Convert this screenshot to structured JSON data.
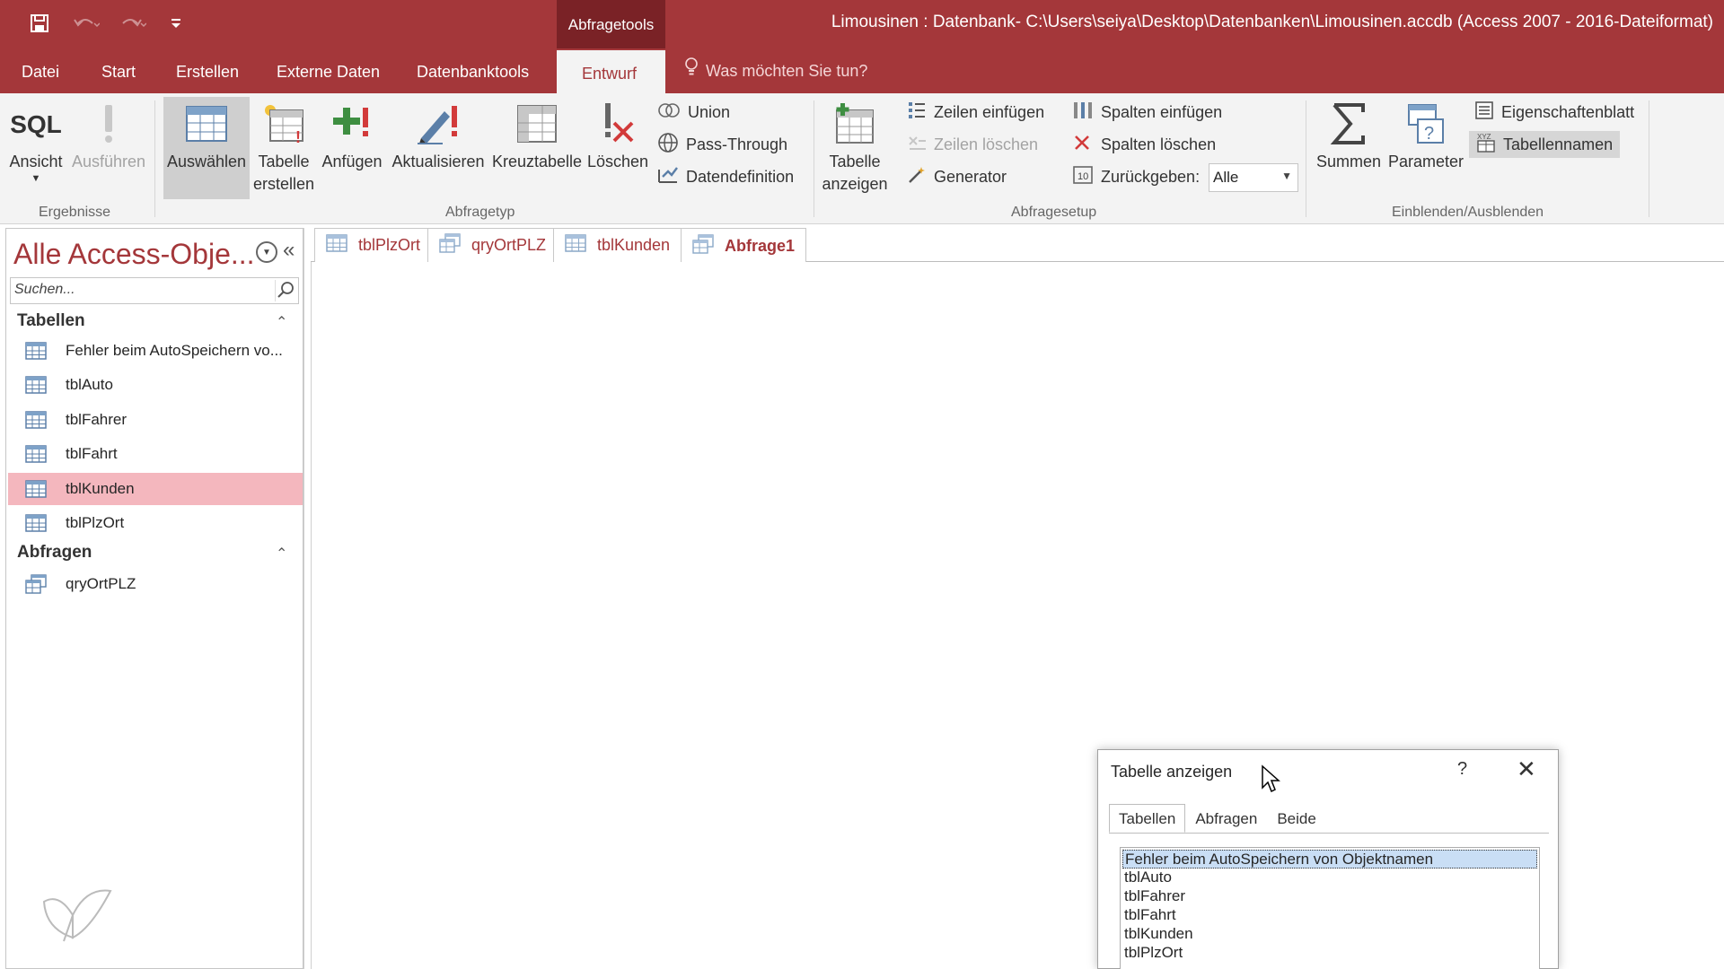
{
  "titlebar": {
    "context_tab_header": "Abfragetools",
    "window_title": "Limousinen : Datenbank- C:\\Users\\seiya\\Desktop\\Datenbanken\\Limousinen.accdb (Access 2007 - 2016-Dateiformat)",
    "qat_icons": [
      "save-icon",
      "undo-icon",
      "redo-icon",
      "customize-qat-icon"
    ]
  },
  "ribbon_tabs": {
    "datei": "Datei",
    "start": "Start",
    "erstellen": "Erstellen",
    "externe_daten": "Externe Daten",
    "datenbanktools": "Datenbanktools",
    "entwurf": "Entwurf",
    "tell_me": "Was möchten Sie tun?"
  },
  "ribbon": {
    "ergebnisse": {
      "label": "Ergebnisse",
      "ansicht_icon_text": "SQL",
      "ansicht": "Ansicht",
      "ausfuehren": "Ausführen"
    },
    "abfragetyp": {
      "label": "Abfragetyp",
      "auswaehlen": "Auswählen",
      "tabelle_erstellen_1": "Tabelle",
      "tabelle_erstellen_2": "erstellen",
      "anfuegen": "Anfügen",
      "aktualisieren": "Aktualisieren",
      "kreuztabelle": "Kreuztabelle",
      "loeschen": "Löschen",
      "union": "Union",
      "pass_through": "Pass-Through",
      "datendefinition": "Datendefinition"
    },
    "abfragesetup": {
      "label": "Abfragesetup",
      "tabelle_anzeigen_1": "Tabelle",
      "tabelle_anzeigen_2": "anzeigen",
      "zeilen_einfuegen": "Zeilen einfügen",
      "zeilen_loeschen": "Zeilen löschen",
      "generator": "Generator",
      "spalten_einfuegen": "Spalten einfügen",
      "spalten_loeschen": "Spalten löschen",
      "zurueckgeben": "Zurückgeben:",
      "zurueckgeben_value": "Alle"
    },
    "einblenden": {
      "label": "Einblenden/Ausblenden",
      "summen": "Summen",
      "parameter": "Parameter",
      "eigenschaftenblatt": "Eigenschaftenblatt",
      "tabellennamen": "Tabellennamen"
    }
  },
  "nav": {
    "title": "Alle Access-Obje...",
    "search_placeholder": "Suchen...",
    "groups": [
      {
        "name": "Tabellen",
        "items": [
          "Fehler beim AutoSpeichern vo...",
          "tblAuto",
          "tblFahrer",
          "tblFahrt",
          "tblKunden",
          "tblPlzOrt"
        ]
      },
      {
        "name": "Abfragen",
        "items": [
          "qryOrtPLZ"
        ]
      }
    ],
    "selected_item": "tblKunden"
  },
  "doc_tabs": [
    "tblPlzOrt",
    "qryOrtPLZ",
    "tblKunden",
    "Abfrage1"
  ],
  "active_doc_tab": "Abfrage1",
  "dialog": {
    "title": "Tabelle anzeigen",
    "help": "?",
    "tabs": [
      "Tabellen",
      "Abfragen",
      "Beide"
    ],
    "active_tab": "Tabellen",
    "items": [
      "Fehler beim AutoSpeichern von Objektnamen",
      "tblAuto",
      "tblFahrer",
      "tblFahrt",
      "tblKunden",
      "tblPlzOrt"
    ]
  },
  "colors": {
    "accent": "#a4373a",
    "context_header": "#7a2226",
    "ribbon_bg": "#f3f3f3",
    "nav_selected": "#f4b7be",
    "list_selected": "#c9def5"
  }
}
